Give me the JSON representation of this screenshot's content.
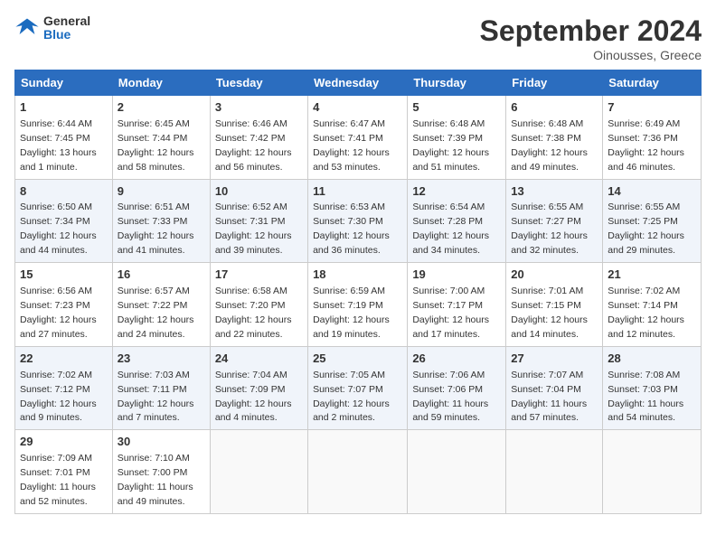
{
  "header": {
    "logo_general": "General",
    "logo_blue": "Blue",
    "month": "September 2024",
    "location": "Oinousses, Greece"
  },
  "days_of_week": [
    "Sunday",
    "Monday",
    "Tuesday",
    "Wednesday",
    "Thursday",
    "Friday",
    "Saturday"
  ],
  "weeks": [
    [
      {
        "day": "1",
        "sunrise": "6:44 AM",
        "sunset": "7:45 PM",
        "daylight": "13 hours and 1 minute."
      },
      {
        "day": "2",
        "sunrise": "6:45 AM",
        "sunset": "7:44 PM",
        "daylight": "12 hours and 58 minutes."
      },
      {
        "day": "3",
        "sunrise": "6:46 AM",
        "sunset": "7:42 PM",
        "daylight": "12 hours and 56 minutes."
      },
      {
        "day": "4",
        "sunrise": "6:47 AM",
        "sunset": "7:41 PM",
        "daylight": "12 hours and 53 minutes."
      },
      {
        "day": "5",
        "sunrise": "6:48 AM",
        "sunset": "7:39 PM",
        "daylight": "12 hours and 51 minutes."
      },
      {
        "day": "6",
        "sunrise": "6:48 AM",
        "sunset": "7:38 PM",
        "daylight": "12 hours and 49 minutes."
      },
      {
        "day": "7",
        "sunrise": "6:49 AM",
        "sunset": "7:36 PM",
        "daylight": "12 hours and 46 minutes."
      }
    ],
    [
      {
        "day": "8",
        "sunrise": "6:50 AM",
        "sunset": "7:34 PM",
        "daylight": "12 hours and 44 minutes."
      },
      {
        "day": "9",
        "sunrise": "6:51 AM",
        "sunset": "7:33 PM",
        "daylight": "12 hours and 41 minutes."
      },
      {
        "day": "10",
        "sunrise": "6:52 AM",
        "sunset": "7:31 PM",
        "daylight": "12 hours and 39 minutes."
      },
      {
        "day": "11",
        "sunrise": "6:53 AM",
        "sunset": "7:30 PM",
        "daylight": "12 hours and 36 minutes."
      },
      {
        "day": "12",
        "sunrise": "6:54 AM",
        "sunset": "7:28 PM",
        "daylight": "12 hours and 34 minutes."
      },
      {
        "day": "13",
        "sunrise": "6:55 AM",
        "sunset": "7:27 PM",
        "daylight": "12 hours and 32 minutes."
      },
      {
        "day": "14",
        "sunrise": "6:55 AM",
        "sunset": "7:25 PM",
        "daylight": "12 hours and 29 minutes."
      }
    ],
    [
      {
        "day": "15",
        "sunrise": "6:56 AM",
        "sunset": "7:23 PM",
        "daylight": "12 hours and 27 minutes."
      },
      {
        "day": "16",
        "sunrise": "6:57 AM",
        "sunset": "7:22 PM",
        "daylight": "12 hours and 24 minutes."
      },
      {
        "day": "17",
        "sunrise": "6:58 AM",
        "sunset": "7:20 PM",
        "daylight": "12 hours and 22 minutes."
      },
      {
        "day": "18",
        "sunrise": "6:59 AM",
        "sunset": "7:19 PM",
        "daylight": "12 hours and 19 minutes."
      },
      {
        "day": "19",
        "sunrise": "7:00 AM",
        "sunset": "7:17 PM",
        "daylight": "12 hours and 17 minutes."
      },
      {
        "day": "20",
        "sunrise": "7:01 AM",
        "sunset": "7:15 PM",
        "daylight": "12 hours and 14 minutes."
      },
      {
        "day": "21",
        "sunrise": "7:02 AM",
        "sunset": "7:14 PM",
        "daylight": "12 hours and 12 minutes."
      }
    ],
    [
      {
        "day": "22",
        "sunrise": "7:02 AM",
        "sunset": "7:12 PM",
        "daylight": "12 hours and 9 minutes."
      },
      {
        "day": "23",
        "sunrise": "7:03 AM",
        "sunset": "7:11 PM",
        "daylight": "12 hours and 7 minutes."
      },
      {
        "day": "24",
        "sunrise": "7:04 AM",
        "sunset": "7:09 PM",
        "daylight": "12 hours and 4 minutes."
      },
      {
        "day": "25",
        "sunrise": "7:05 AM",
        "sunset": "7:07 PM",
        "daylight": "12 hours and 2 minutes."
      },
      {
        "day": "26",
        "sunrise": "7:06 AM",
        "sunset": "7:06 PM",
        "daylight": "11 hours and 59 minutes."
      },
      {
        "day": "27",
        "sunrise": "7:07 AM",
        "sunset": "7:04 PM",
        "daylight": "11 hours and 57 minutes."
      },
      {
        "day": "28",
        "sunrise": "7:08 AM",
        "sunset": "7:03 PM",
        "daylight": "11 hours and 54 minutes."
      }
    ],
    [
      {
        "day": "29",
        "sunrise": "7:09 AM",
        "sunset": "7:01 PM",
        "daylight": "11 hours and 52 minutes."
      },
      {
        "day": "30",
        "sunrise": "7:10 AM",
        "sunset": "7:00 PM",
        "daylight": "11 hours and 49 minutes."
      },
      null,
      null,
      null,
      null,
      null
    ]
  ]
}
